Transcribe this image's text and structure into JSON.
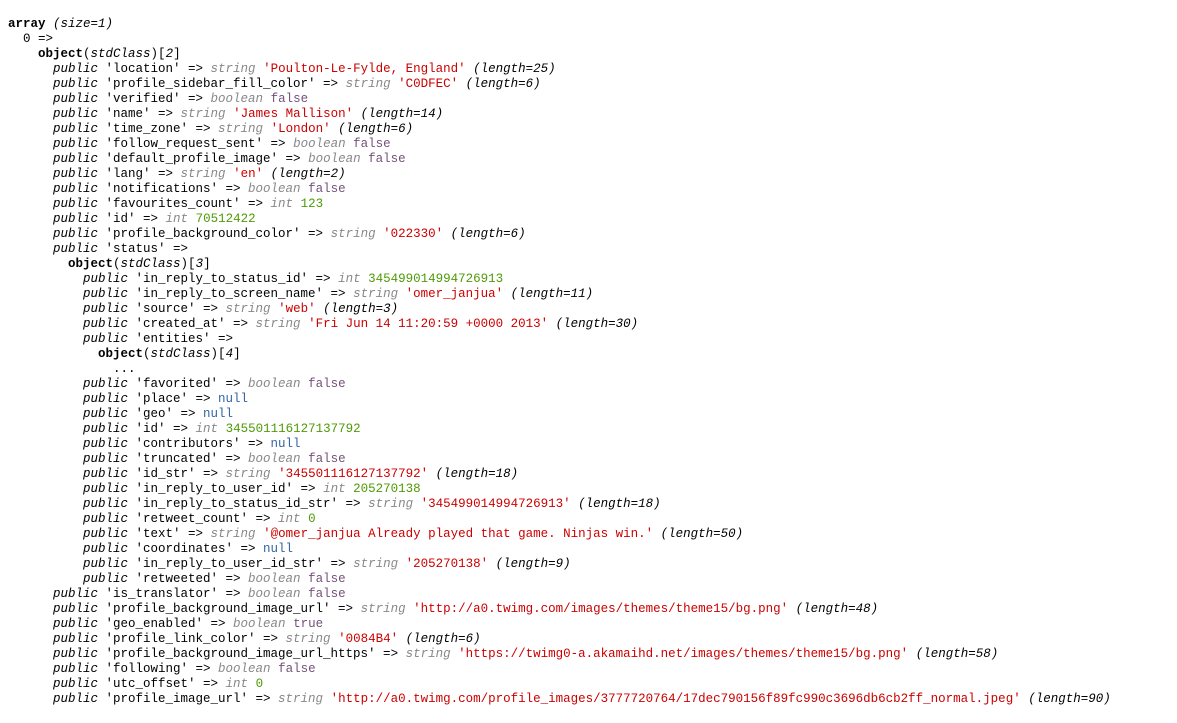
{
  "header": {
    "array_label": "array",
    "array_size": "(size=1)",
    "index0": "0",
    "arrow": "=>",
    "object_label": "object",
    "class_root": "stdClass",
    "root_ordinal": "2",
    "status_ordinal": "3",
    "entities_ordinal": "4",
    "ellipsis": "..."
  },
  "kw": {
    "public": "public",
    "string": "string",
    "boolean": "boolean",
    "int": "int",
    "null": "null"
  },
  "root": {
    "location": {
      "key": "'location'",
      "value": "'Poulton-Le-Fylde, England'",
      "len": "(length=25)"
    },
    "profile_sidebar_fill_color": {
      "key": "'profile_sidebar_fill_color'",
      "value": "'C0DFEC'",
      "len": "(length=6)"
    },
    "verified": {
      "key": "'verified'",
      "value": "false"
    },
    "name": {
      "key": "'name'",
      "value": "'James Mallison'",
      "len": "(length=14)"
    },
    "time_zone": {
      "key": "'time_zone'",
      "value": "'London'",
      "len": "(length=6)"
    },
    "follow_request_sent": {
      "key": "'follow_request_sent'",
      "value": "false"
    },
    "default_profile_image": {
      "key": "'default_profile_image'",
      "value": "false"
    },
    "lang": {
      "key": "'lang'",
      "value": "'en'",
      "len": "(length=2)"
    },
    "notifications": {
      "key": "'notifications'",
      "value": "false"
    },
    "favourites_count": {
      "key": "'favourites_count'",
      "value": "123"
    },
    "id": {
      "key": "'id'",
      "value": "70512422"
    },
    "profile_background_color": {
      "key": "'profile_background_color'",
      "value": "'022330'",
      "len": "(length=6)"
    },
    "status_key": "'status'",
    "is_translator": {
      "key": "'is_translator'",
      "value": "false"
    },
    "profile_background_image_url": {
      "key": "'profile_background_image_url'",
      "value": "'http://a0.twimg.com/images/themes/theme15/bg.png'",
      "len": "(length=48)"
    },
    "geo_enabled": {
      "key": "'geo_enabled'",
      "value": "true"
    },
    "profile_link_color": {
      "key": "'profile_link_color'",
      "value": "'0084B4'",
      "len": "(length=6)"
    },
    "profile_background_image_url_https": {
      "key": "'profile_background_image_url_https'",
      "value": "'https://twimg0-a.akamaihd.net/images/themes/theme15/bg.png'",
      "len": "(length=58)"
    },
    "following": {
      "key": "'following'",
      "value": "false"
    },
    "utc_offset": {
      "key": "'utc_offset'",
      "value": "0"
    },
    "profile_image_url": {
      "key": "'profile_image_url'",
      "value": "'http://a0.twimg.com/profile_images/3777720764/17dec790156f89fc990c3696db6cb2ff_normal.jpeg'",
      "len": "(length=90)"
    }
  },
  "status": {
    "in_reply_to_status_id": {
      "key": "'in_reply_to_status_id'",
      "value": "345499014994726913"
    },
    "in_reply_to_screen_name": {
      "key": "'in_reply_to_screen_name'",
      "value": "'omer_janjua'",
      "len": "(length=11)"
    },
    "source": {
      "key": "'source'",
      "value": "'web'",
      "len": "(length=3)"
    },
    "created_at": {
      "key": "'created_at'",
      "value": "'Fri Jun 14 11:20:59 +0000 2013'",
      "len": "(length=30)"
    },
    "entities_key": "'entities'",
    "favorited": {
      "key": "'favorited'",
      "value": "false"
    },
    "place": {
      "key": "'place'"
    },
    "geo": {
      "key": "'geo'"
    },
    "id": {
      "key": "'id'",
      "value": "345501116127137792"
    },
    "contributors": {
      "key": "'contributors'"
    },
    "truncated": {
      "key": "'truncated'",
      "value": "false"
    },
    "id_str": {
      "key": "'id_str'",
      "value": "'345501116127137792'",
      "len": "(length=18)"
    },
    "in_reply_to_user_id": {
      "key": "'in_reply_to_user_id'",
      "value": "205270138"
    },
    "in_reply_to_status_id_str": {
      "key": "'in_reply_to_status_id_str'",
      "value": "'345499014994726913'",
      "len": "(length=18)"
    },
    "retweet_count": {
      "key": "'retweet_count'",
      "value": "0"
    },
    "text": {
      "key": "'text'",
      "value": "'@omer_janjua Already played that game. Ninjas win.'",
      "len": "(length=50)"
    },
    "coordinates": {
      "key": "'coordinates'"
    },
    "in_reply_to_user_id_str": {
      "key": "'in_reply_to_user_id_str'",
      "value": "'205270138'",
      "len": "(length=9)"
    },
    "retweeted": {
      "key": "'retweeted'",
      "value": "false"
    }
  }
}
